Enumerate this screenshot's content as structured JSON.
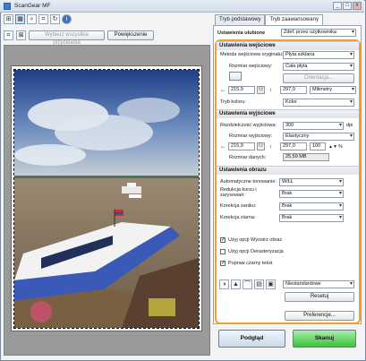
{
  "window": {
    "title": "ScanGear MF",
    "controls": [
      "_",
      "□",
      "x"
    ]
  },
  "toolbar": {
    "icons": [
      "scan-mode-icon",
      "select-area-icon",
      "zoom-icon",
      "crop-icon",
      "rotate-icon",
      "info-icon"
    ],
    "crop_all_label": "Wybierz wszystkie przycinania",
    "zoom_button": "Powiększenie"
  },
  "tabs": {
    "basic": "Tryb podstawowy",
    "advanced": "Tryb zaawansowany"
  },
  "favorites": {
    "label": "Ustawienia ulubione",
    "value": "Zdef. przez użytkownika"
  },
  "input_settings": {
    "header": "Ustawienia wejściowe",
    "source_label": "Metoda wejściowa oryginału:",
    "source_value": "Płyta szklana",
    "size_label": "Rozmiar wejściowy:",
    "size_value": "Cała płyta",
    "orientation_button": "Orientacja...",
    "width": "215,9",
    "height": "297,0",
    "unit": "Milimetry",
    "color_label": "Tryb koloru:",
    "color_value": "Kolor"
  },
  "output_settings": {
    "header": "Ustawienia wyjściowe",
    "resolution_label": "Rozdzielczość wyjściowa:",
    "resolution_value": "300",
    "dpi": "dpi",
    "size_label": "Rozmiar wyjściowy:",
    "size_value": "Elastyczny",
    "width": "215,9",
    "height": "297,0",
    "scale": "100",
    "percent": "%",
    "data_size_label": "Rozmiar danych:",
    "data_size_value": "25,59 MB"
  },
  "image_settings": {
    "header": "Ustawienia obrazu",
    "auto_tone_label": "Automatyczne tonowanie:",
    "auto_tone_value": "W/ŁŁ",
    "dust_label": "Redukcja kurzu i zarysowań:",
    "dust_value": "Brak",
    "fading_label": "Korekcja zaniku:",
    "fading_value": "Brak",
    "grain_label": "Korekcja ziarna:",
    "grain_value": "Brak",
    "unsharp_label": "Użyj opcji Wyostrz obraz",
    "descreen_label": "Użyj opcji Derasteryzacja",
    "text_enhance_label": "Popraw czarny tekst"
  },
  "adjust": {
    "icons": [
      "brightness-icon",
      "histogram-icon",
      "curve-icon",
      "levels-icon",
      "final-review-icon"
    ],
    "preset_value": "Niestandardowe",
    "reset_button": "Resetuj"
  },
  "preferences_button": "Preferencje...",
  "preview_button": "Podgląd",
  "scan_button": "Skanuj",
  "colors": {
    "accent_orange": "#f0a030",
    "scan_green": "#4fc44f",
    "preview_blue": "#dce6f3"
  }
}
